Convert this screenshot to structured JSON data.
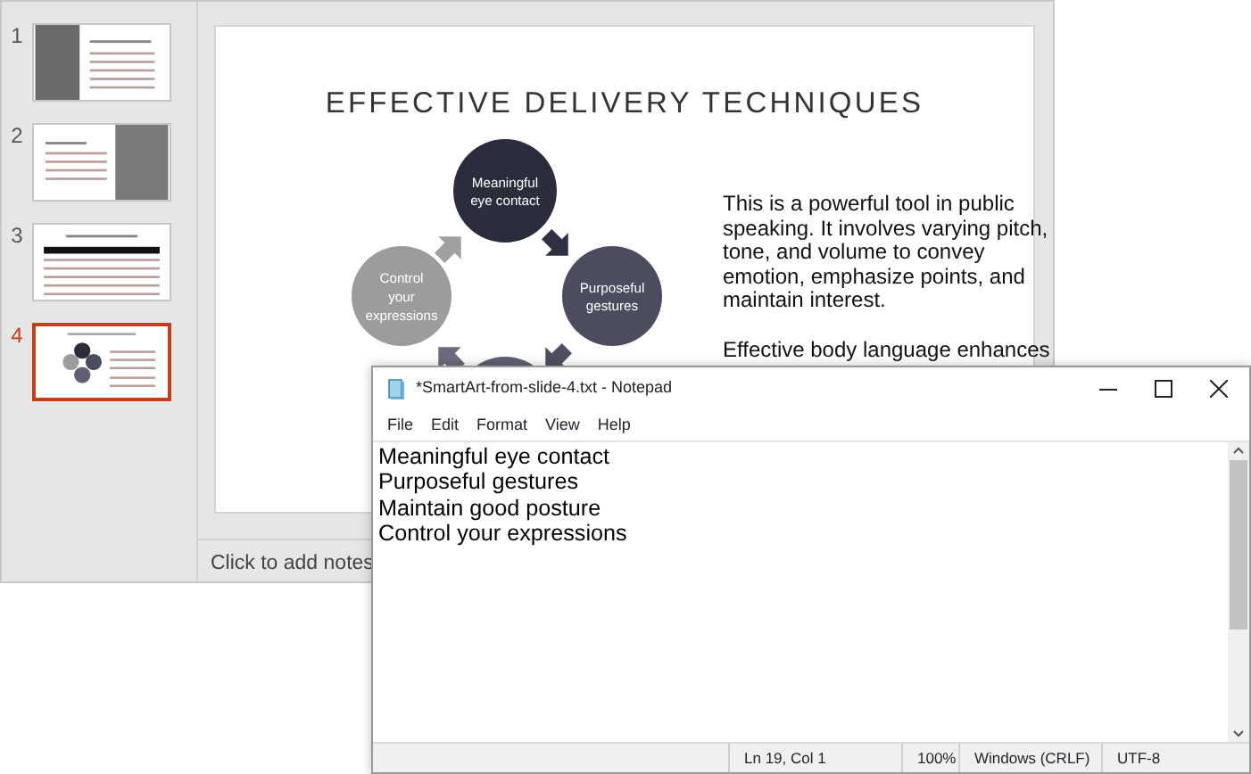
{
  "presentation": {
    "thumbnails": [
      {
        "number": "1",
        "kind": "photo-left",
        "selected": false
      },
      {
        "number": "2",
        "kind": "photo-right",
        "selected": false
      },
      {
        "number": "3",
        "kind": "table",
        "selected": false
      },
      {
        "number": "4",
        "kind": "cycle",
        "selected": true
      }
    ],
    "slide": {
      "title": "EFFECTIVE DELIVERY TECHNIQUES",
      "nodes": [
        {
          "label": "Meaningful eye contact",
          "color": "#2b2d3d"
        },
        {
          "label": "Control your expressions",
          "color": "#9c9c9e"
        },
        {
          "label": "Purposeful gestures",
          "color": "#4b4d5f"
        }
      ],
      "paragraphs": [
        "This is a powerful tool in public speaking. It involves varying pitch, tone, and volume to convey emotion, emphasize points, and maintain interest.",
        "Effective body language enhances"
      ]
    },
    "notes_placeholder": "Click to add notes"
  },
  "notepad": {
    "title": "*SmartArt-from-slide-4.txt - Notepad",
    "menu": [
      "File",
      "Edit",
      "Format",
      "View",
      "Help"
    ],
    "lines": [
      "Meaningful eye contact",
      "Purposeful gestures",
      "Maintain good posture",
      "Control your expressions"
    ],
    "status_bar": [
      "Ln 19, Col 1",
      "100%",
      "Windows (CRLF)",
      "UTF-8"
    ]
  }
}
